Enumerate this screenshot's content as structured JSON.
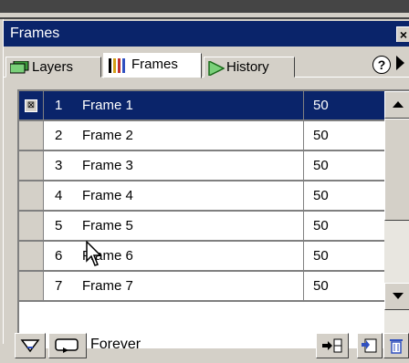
{
  "panel": {
    "title": "Frames",
    "close_glyph": "×",
    "tabs": [
      {
        "label": "Layers",
        "icon": "layers-icon",
        "active": false
      },
      {
        "label": "Frames",
        "icon": "frames-icon",
        "active": true
      },
      {
        "label": "History",
        "icon": "history-icon",
        "active": false
      }
    ],
    "help_glyph": "?"
  },
  "frames": [
    {
      "num": "1",
      "name": "Frame 1",
      "delay": "50",
      "selected": true
    },
    {
      "num": "2",
      "name": "Frame 2",
      "delay": "50"
    },
    {
      "num": "3",
      "name": "Frame 3",
      "delay": "50"
    },
    {
      "num": "4",
      "name": "Frame 4",
      "delay": "50"
    },
    {
      "num": "5",
      "name": "Frame 5",
      "delay": "50"
    },
    {
      "num": "6",
      "name": "Frame 6",
      "delay": "50"
    },
    {
      "num": "7",
      "name": "Frame 7",
      "delay": "50"
    }
  ],
  "footer": {
    "loop_label": "Forever"
  },
  "colors": {
    "selection": "#0a246a",
    "face": "#d4d0c8"
  }
}
